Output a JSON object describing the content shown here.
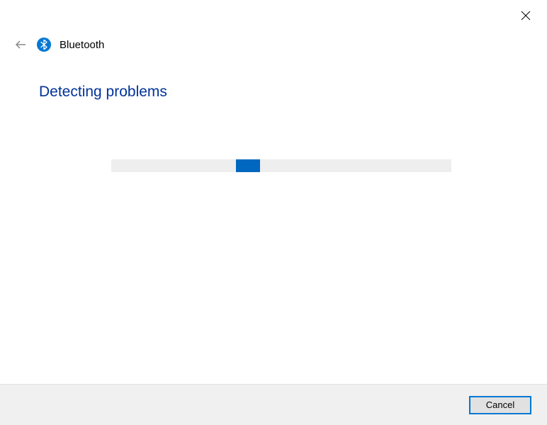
{
  "window": {
    "title": "Bluetooth"
  },
  "content": {
    "heading": "Detecting problems"
  },
  "footer": {
    "cancel_label": "Cancel"
  }
}
